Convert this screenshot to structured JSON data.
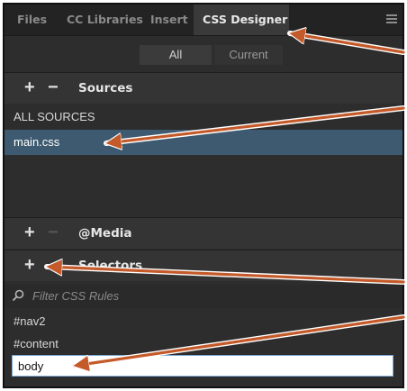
{
  "tabs": [
    {
      "label": "Files",
      "active": false
    },
    {
      "label": "CC Libraries",
      "active": false
    },
    {
      "label": "Insert",
      "active": false
    },
    {
      "label": "CSS Designer",
      "active": true
    }
  ],
  "panel_menu_icon": "hamburger-menu-icon",
  "toggle": {
    "all": "All",
    "current": "Current"
  },
  "sources": {
    "add": "+",
    "remove": "−",
    "title": "Sources",
    "items": [
      "ALL SOURCES",
      "main.css"
    ],
    "selected_index": 1
  },
  "media": {
    "add": "+",
    "remove": "−",
    "title": "@Media"
  },
  "selectors": {
    "add": "+",
    "title": "Selectors",
    "filter_placeholder": "Filter CSS Rules",
    "items": [
      "#nav2",
      "#content"
    ],
    "new_selector_value": "body"
  },
  "colors": {
    "panel_bg": "#2d2d2d",
    "selection": "#3d5a70",
    "annotation_arrow": "#c45a2a"
  }
}
